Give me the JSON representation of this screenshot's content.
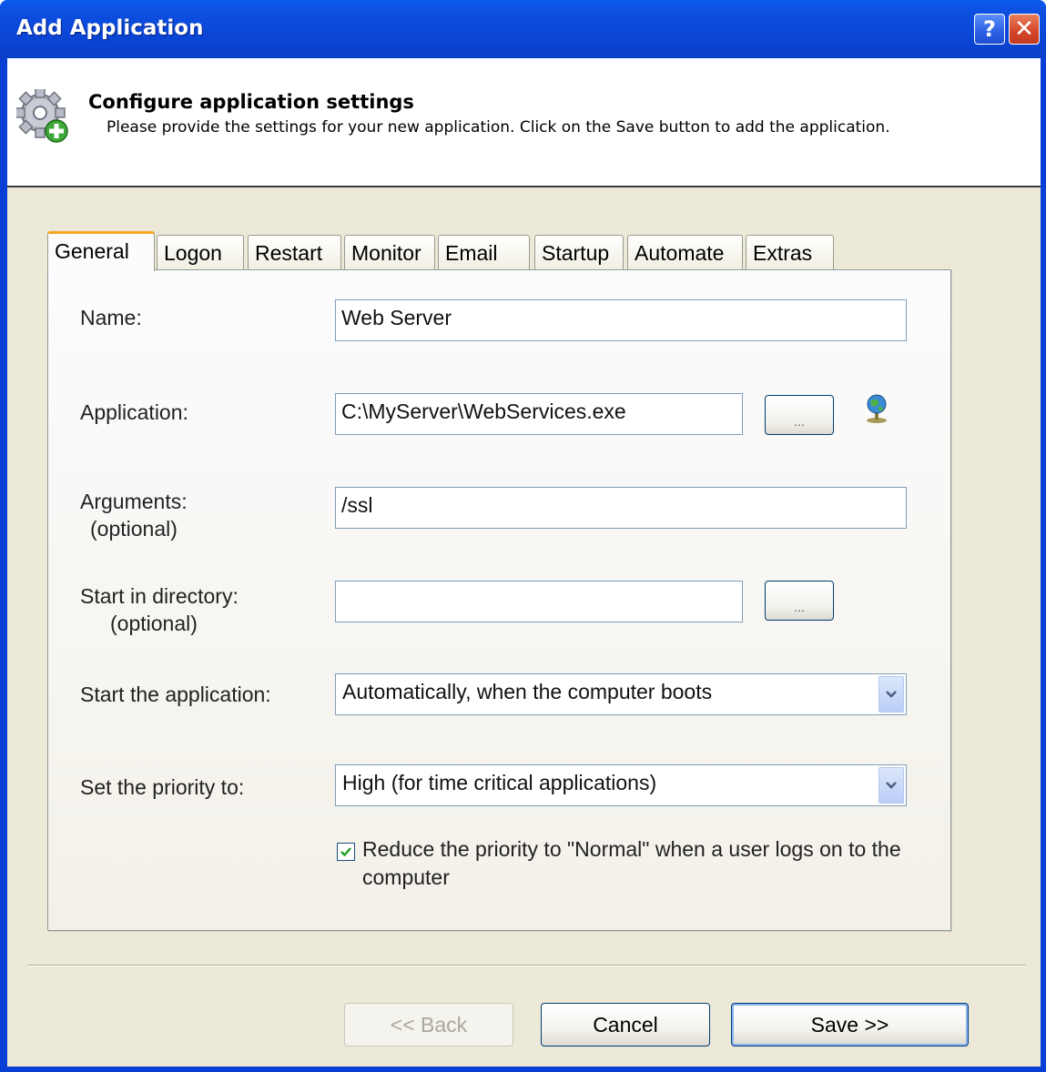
{
  "window": {
    "title": "Add Application",
    "help_label": "?",
    "close_label": "✕"
  },
  "header": {
    "title": "Configure application settings",
    "subtitle": "Please provide the settings for your new application. Click on the Save button to add the application."
  },
  "tabs": [
    {
      "label": "General",
      "active": true
    },
    {
      "label": "Logon"
    },
    {
      "label": "Restart"
    },
    {
      "label": "Monitor"
    },
    {
      "label": "Email"
    },
    {
      "label": "Startup"
    },
    {
      "label": "Automate"
    },
    {
      "label": "Extras"
    }
  ],
  "form": {
    "name_label": "Name:",
    "name_value": "Web Server",
    "application_label": "Application:",
    "application_value": "C:\\MyServer\\WebServices.exe",
    "browse_label": "...",
    "arguments_label": "Arguments:",
    "arguments_optional": "(optional)",
    "arguments_value": "/ssl",
    "start_dir_label": "Start in directory:",
    "start_dir_optional": "(optional)",
    "start_dir_value": "",
    "start_app_label": "Start the application:",
    "start_app_value": "Automatically, when the computer boots",
    "priority_label": "Set the priority to:",
    "priority_value": "High (for time critical applications)",
    "reduce_priority_checked": true,
    "reduce_priority_label": "Reduce the priority to \"Normal\" when a user logs on to the computer"
  },
  "buttons": {
    "back": "<< Back",
    "cancel": "Cancel",
    "save": "Save >>"
  },
  "colors": {
    "titlebar": "#0b47d8",
    "dialog_bg": "#ece9d8",
    "active_tab_accent": "#f5a623"
  },
  "icons": [
    "gear-add-icon",
    "globe-icon",
    "help-icon",
    "close-icon",
    "chevron-down-icon",
    "checkmark-icon"
  ]
}
